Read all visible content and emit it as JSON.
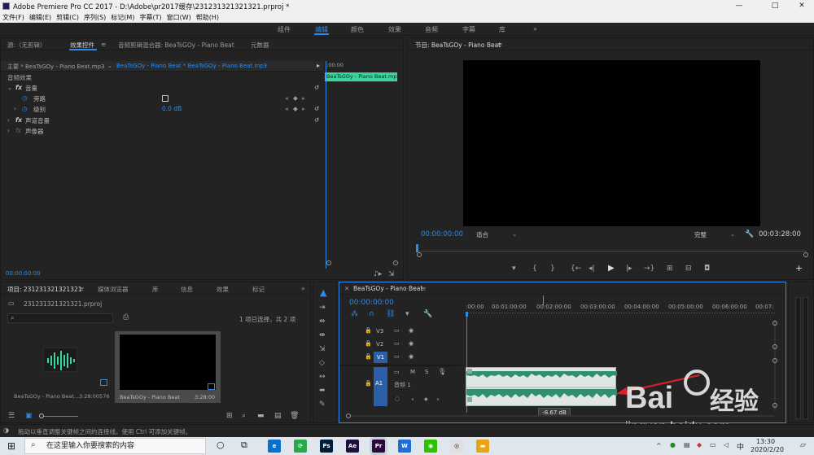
{
  "window": {
    "title": "Adobe Premiere Pro CC 2017 - D:\\Adobe\\pr2017缓存\\231231321321321.prproj *",
    "min": "—",
    "max": "□",
    "close": "✕"
  },
  "menu": [
    "文件(F)",
    "编辑(E)",
    "剪辑(C)",
    "序列(S)",
    "标记(M)",
    "字幕(T)",
    "窗口(W)",
    "帮助(H)"
  ],
  "workspaces": {
    "items": [
      "组件",
      "编辑",
      "颜色",
      "效果",
      "音频",
      "字幕",
      "库"
    ],
    "active": "编辑",
    "more": "»"
  },
  "effects_panel": {
    "tabs": [
      "源:（无剪辑）",
      "效果控件",
      "音频剪辑混合器: BeaTsGOy - Piano Beat",
      "元数据"
    ],
    "active_tab": "效果控件",
    "menu_icon": "≡",
    "master": "主要 * BeaTsGOy - Piano Beat.mp3",
    "sequence_clip": "BeaTsGOy - Piano Beat * BeaTsGOy - Piano Beat.mp3",
    "timecode_start": ":00:00",
    "clip_label": "BeaTsGOy - Piano Beat.mp3",
    "section": "音频效果",
    "rows": [
      {
        "label": "音量",
        "kind": "fx"
      },
      {
        "label": "旁路",
        "kind": "param",
        "value": ""
      },
      {
        "label": "级别",
        "kind": "param",
        "value": "0.0 dB"
      },
      {
        "label": "声道音量",
        "kind": "fx"
      },
      {
        "label": "声像器",
        "kind": "fx"
      }
    ],
    "timecode": "00:00:00:00"
  },
  "program_monitor": {
    "title": "节目: BeaTsGOy - Piano Beat",
    "menu_icon": "≡",
    "timecode": "00:00:00:00",
    "fit": "适合",
    "quality": "完整",
    "duration": "00:03:28:00",
    "buttons": [
      "▾",
      "{",
      "}",
      "{←",
      "◂|",
      "▶",
      "|▸",
      "→}",
      "⊞",
      "⊟",
      "◘"
    ],
    "add": "+"
  },
  "project_panel": {
    "tabs": [
      "项目: 231231321321321",
      "媒体浏览器",
      "库",
      "信息",
      "效果",
      "标记"
    ],
    "menu_icon": "≡",
    "more": "»",
    "file": "231231321321321.prproj",
    "selection": "1 项已选择，共 2 项",
    "items": [
      {
        "name": "BeaTsGOy - Piano Beat...",
        "duration": "3:28:00576"
      },
      {
        "name": "BeaTsGOy - Piano Beat",
        "duration": "3:28:00"
      }
    ]
  },
  "timeline": {
    "close": "✕",
    "title": "BeaTsGOy - Piano Beat",
    "menu_icon": "≡",
    "timecode": "00:00:00:00",
    "ruler": [
      ":00:00",
      "00:01:00:00",
      "00:02:00:00",
      "00:03:00:00",
      "00:04:00:00",
      "00:05:00:00",
      "00:06:00:00",
      "00:07:"
    ],
    "tracks": [
      "V3",
      "V2",
      "V1",
      "A1"
    ],
    "a1_name": "音频 1",
    "a1_m": "M",
    "a1_s": "S",
    "level_tooltip": "-8.67 dB"
  },
  "status": {
    "hint": "拖动以垂直调整关键帧之间的连接线。使用 Ctrl 可添加关键帧。"
  },
  "taskbar": {
    "search_placeholder": "在这里输入你要搜索的内容",
    "apps": [
      {
        "label": "e",
        "color": "#0b6fcd"
      },
      {
        "label": "⟳",
        "color": "#2aa84a"
      },
      {
        "label": "Ps",
        "color": "#001e36"
      },
      {
        "label": "Ae",
        "color": "#1f0f3d"
      },
      {
        "label": "Pr",
        "color": "#2a0a3d"
      },
      {
        "label": "W",
        "color": "#1e6fd0"
      },
      {
        "label": "◉",
        "color": "#2dc100"
      },
      {
        "label": "◎",
        "color": "#e0e0e0"
      },
      {
        "label": "▬",
        "color": "#e8a317"
      }
    ],
    "time": "13:30",
    "date": "2020/2/20",
    "lang": "中"
  },
  "watermark": {
    "brand": "Bai",
    "brand2": "经验",
    "url": "jingyan.baidu.com"
  },
  "colors": {
    "accent": "#2d8ceb",
    "clip_green": "#3bd49a",
    "audio_wave": "#2f8f6e",
    "track_blue": "#2b5fa7"
  }
}
